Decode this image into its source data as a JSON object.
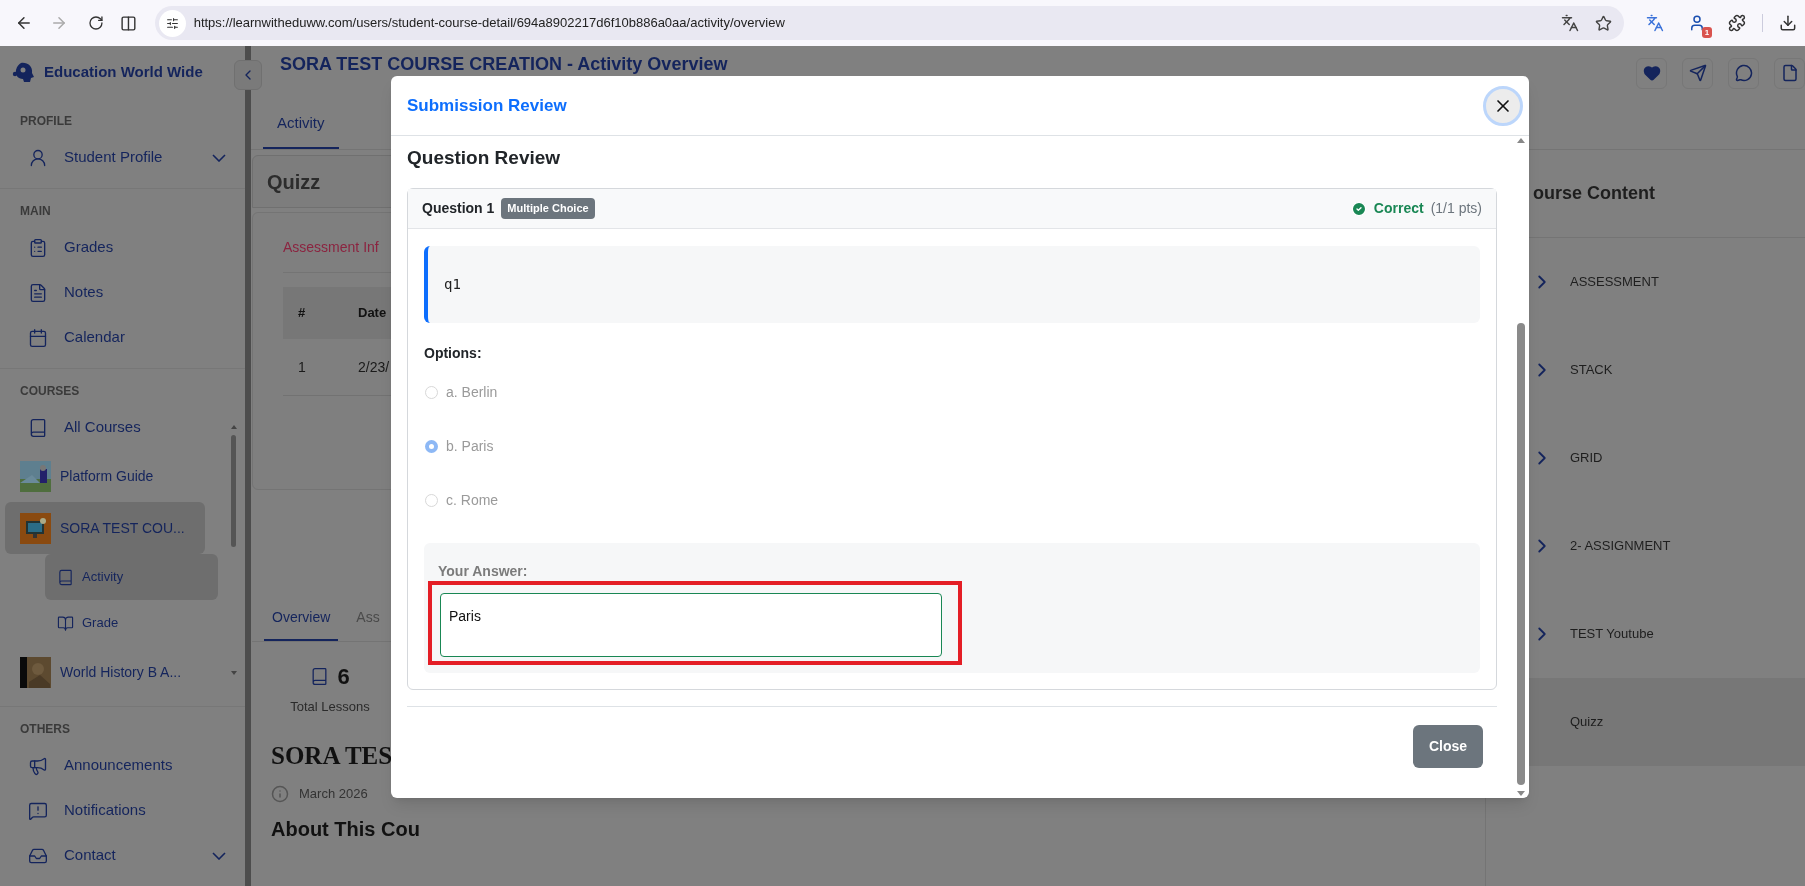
{
  "browser": {
    "url": "https://learnwitheduww.com/users/student-course-detail/694a8902217d6f10b886a0aa/activity/overview",
    "profile_badge": "1"
  },
  "sidebar": {
    "brand": "Education World Wide",
    "sections": [
      {
        "heading": "PROFILE",
        "items": [
          {
            "kind": "group",
            "label": "Student Profile",
            "selected": false
          }
        ]
      },
      {
        "heading": "MAIN",
        "items": [
          {
            "kind": "nav",
            "label": "Grades",
            "selected": false
          },
          {
            "kind": "nav",
            "label": "Notes",
            "selected": false
          },
          {
            "kind": "nav",
            "label": "Calendar",
            "selected": false
          }
        ]
      },
      {
        "heading": "COURSES",
        "items": [
          {
            "kind": "nav",
            "label": "All Courses",
            "selected": false
          },
          {
            "kind": "course",
            "label": "Platform Guide",
            "selected": false
          },
          {
            "kind": "course",
            "label": "SORA TEST COU...",
            "selected": true
          },
          {
            "kind": "sub",
            "label": "Activity",
            "selected": true
          },
          {
            "kind": "sub",
            "label": "Grade",
            "selected": false
          },
          {
            "kind": "course",
            "label": "World History B A...",
            "selected": false
          }
        ]
      },
      {
        "heading": "OTHERS",
        "items": [
          {
            "kind": "nav",
            "label": "Announcements",
            "selected": false
          },
          {
            "kind": "nav",
            "label": "Notifications",
            "selected": false
          },
          {
            "kind": "group",
            "label": "Contact",
            "selected": false
          }
        ]
      }
    ]
  },
  "header": {
    "title": "SORA TEST COURSE CREATION - Activity Overview"
  },
  "main": {
    "tabs": [
      {
        "label": "Activity",
        "selected": true
      }
    ],
    "card_title": "Quizz",
    "card_tab": "Assessment Inf",
    "table": {
      "columns": [
        "#",
        "Date"
      ],
      "rows": [
        [
          "1",
          "2/23/"
        ]
      ]
    },
    "overview_tabs": [
      {
        "label": "Overview",
        "selected": true
      },
      {
        "label": "Ass",
        "selected": false
      }
    ],
    "stat": {
      "value": "6",
      "label": "Total Lessons"
    },
    "course_title": "SORA TES",
    "date": "March 2026",
    "about": "About This Cou"
  },
  "course_content": {
    "heading": "ourse Content",
    "items": [
      {
        "label": "ASSESSMENT",
        "selected": false
      },
      {
        "label": "STACK",
        "selected": false
      },
      {
        "label": "GRID",
        "selected": false
      },
      {
        "label": "2- ASSIGNMENT",
        "selected": false
      },
      {
        "label": "TEST Youtube",
        "selected": false
      },
      {
        "label": "Quizz",
        "selected": true
      }
    ]
  },
  "modal": {
    "title": "Submission Review",
    "section_title": "Question Review",
    "question": {
      "label": "Question 1",
      "type": "Multiple Choice",
      "correct": true,
      "result": "Correct",
      "points": "(1/1 pts)",
      "prompt": "q1",
      "options_label": "Options:",
      "options": [
        {
          "label": "a. Berlin",
          "selected": false
        },
        {
          "label": "b. Paris",
          "selected": true
        },
        {
          "label": "c. Rome",
          "selected": false
        }
      ],
      "answer_label": "Your Answer:",
      "answer": "Paris"
    },
    "close": "Close"
  }
}
